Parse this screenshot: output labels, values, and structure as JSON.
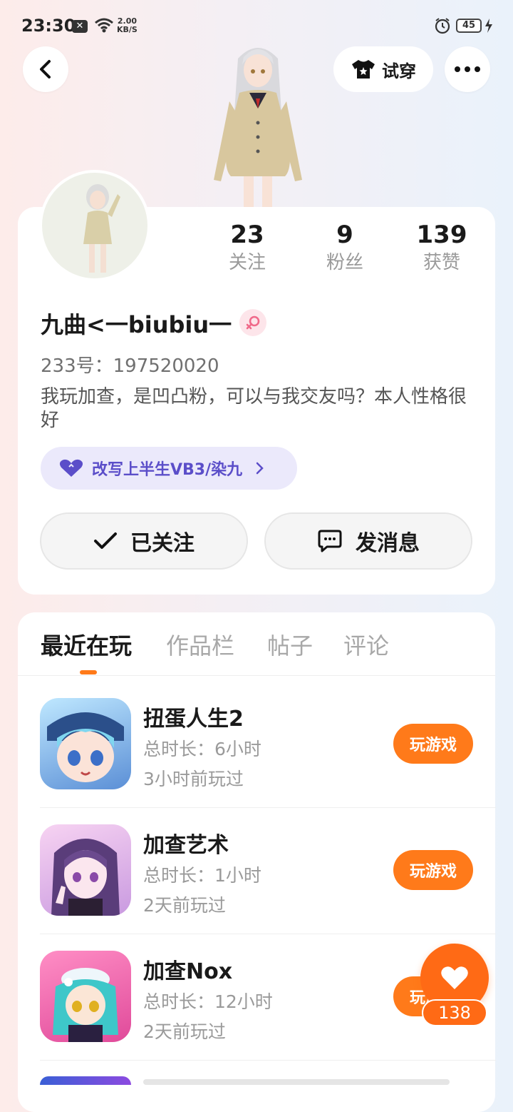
{
  "status_bar": {
    "time": "23:30",
    "net_speed_value": "2.00",
    "net_speed_unit": "KB/S",
    "battery": "45",
    "icons": [
      "notification-x-icon",
      "wifi-icon",
      "alarm-icon",
      "battery-icon",
      "charging-icon"
    ]
  },
  "header": {
    "try_on_label": "试穿",
    "icons": [
      "back-icon",
      "tshirt-icon",
      "more-icon"
    ]
  },
  "profile": {
    "stats": [
      {
        "value": "23",
        "label": "关注"
      },
      {
        "value": "9",
        "label": "粉丝"
      },
      {
        "value": "139",
        "label": "获赞"
      }
    ],
    "username": "九曲<一biubiu一",
    "gender": "female",
    "uid": "233号：197520020",
    "bio": "我玩加查，是凹凸粉，可以与我交友吗？本人性格很好",
    "tag": "改写上半生VB3/染九",
    "follow_label": "已关注",
    "message_label": "发消息"
  },
  "tabs": [
    {
      "label": "最近在玩",
      "active": true
    },
    {
      "label": "作品栏",
      "active": false
    },
    {
      "label": "帖子",
      "active": false
    },
    {
      "label": "评论",
      "active": false
    }
  ],
  "games": [
    {
      "name": "扭蛋人生2",
      "duration": "总时长：6小时",
      "last_played": "3小时前玩过",
      "button": "玩游戏"
    },
    {
      "name": "加查艺术",
      "duration": "总时长：1小时",
      "last_played": "2天前玩过",
      "button": "玩游戏"
    },
    {
      "name": "加查Nox",
      "duration": "总时长：12小时",
      "last_played": "2天前玩过",
      "button": "玩游戏"
    }
  ],
  "like_fab": {
    "count": "138"
  },
  "colors": {
    "accent": "#ff7a1a",
    "tag_bg": "#ebe9fb",
    "tag_text": "#5b4ec9"
  }
}
